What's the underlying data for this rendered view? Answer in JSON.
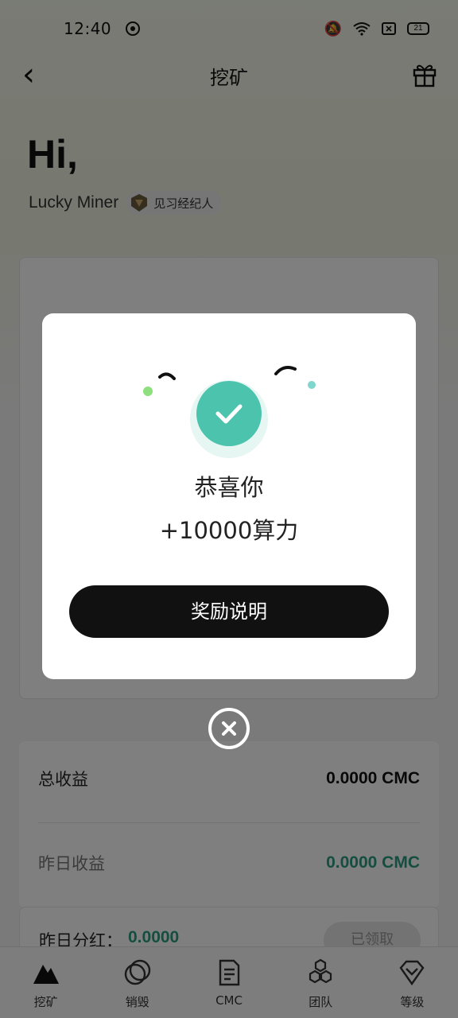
{
  "status_bar": {
    "time": "12:40",
    "battery": "21",
    "icons": [
      "mute-icon",
      "wifi-icon",
      "sim-icon",
      "battery-icon"
    ]
  },
  "header": {
    "title": "挖矿",
    "back_icon": "chevron-left-icon",
    "right_icon": "gift-icon"
  },
  "greeting": {
    "hi": "Hi,",
    "username": "Lucky Miner",
    "rank": "见习经纪人"
  },
  "income": {
    "total_label": "总收益",
    "total_value": "0.0000 CMC",
    "yesterday_label": "昨日收益",
    "yesterday_value": "0.0000 CMC"
  },
  "dividend": {
    "label": "昨日分红：",
    "value": "0.0000",
    "button": "已领取"
  },
  "tabs": [
    {
      "label": "挖矿",
      "icon": "mountain-icon"
    },
    {
      "label": "销毁",
      "icon": "coins-icon"
    },
    {
      "label": "CMC",
      "icon": "document-icon"
    },
    {
      "label": "团队",
      "icon": "hexagons-icon"
    },
    {
      "label": "等级",
      "icon": "diamond-icon"
    }
  ],
  "modal": {
    "title": "恭喜你",
    "reward": "+10000算力",
    "button": "奖励说明",
    "icon": "check-circle-icon"
  },
  "colors": {
    "accent_green": "#4cc3ad",
    "value_green": "#2a9d80",
    "dark_button": "#111111"
  }
}
